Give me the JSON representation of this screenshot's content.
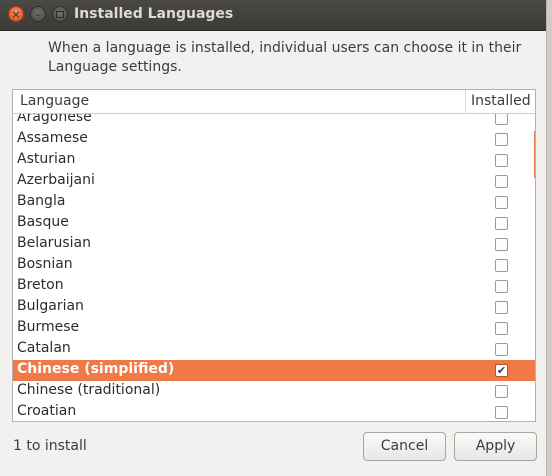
{
  "window": {
    "title": "Installed Languages",
    "description_line1": "When a language is installed, individual users can choose it in their",
    "description_line2": "Language settings."
  },
  "table": {
    "headers": {
      "language": "Language",
      "installed": "Installed"
    },
    "rows": [
      {
        "name": "Aragonese",
        "installed": false,
        "selected": false
      },
      {
        "name": "Assamese",
        "installed": false,
        "selected": false
      },
      {
        "name": "Asturian",
        "installed": false,
        "selected": false
      },
      {
        "name": "Azerbaijani",
        "installed": false,
        "selected": false
      },
      {
        "name": "Bangla",
        "installed": false,
        "selected": false
      },
      {
        "name": "Basque",
        "installed": false,
        "selected": false
      },
      {
        "name": "Belarusian",
        "installed": false,
        "selected": false
      },
      {
        "name": "Bosnian",
        "installed": false,
        "selected": false
      },
      {
        "name": "Breton",
        "installed": false,
        "selected": false
      },
      {
        "name": "Bulgarian",
        "installed": false,
        "selected": false
      },
      {
        "name": "Burmese",
        "installed": false,
        "selected": false
      },
      {
        "name": "Catalan",
        "installed": false,
        "selected": false
      },
      {
        "name": "Chinese (simplified)",
        "installed": true,
        "selected": true
      },
      {
        "name": "Chinese (traditional)",
        "installed": false,
        "selected": false
      },
      {
        "name": "Croatian",
        "installed": false,
        "selected": false
      }
    ]
  },
  "footer": {
    "status": "1 to install",
    "cancel_label": "Cancel",
    "apply_label": "Apply"
  },
  "colors": {
    "selection": "#ef7a48",
    "titlebar": "#3c3b37",
    "close_button": "#e95420"
  }
}
